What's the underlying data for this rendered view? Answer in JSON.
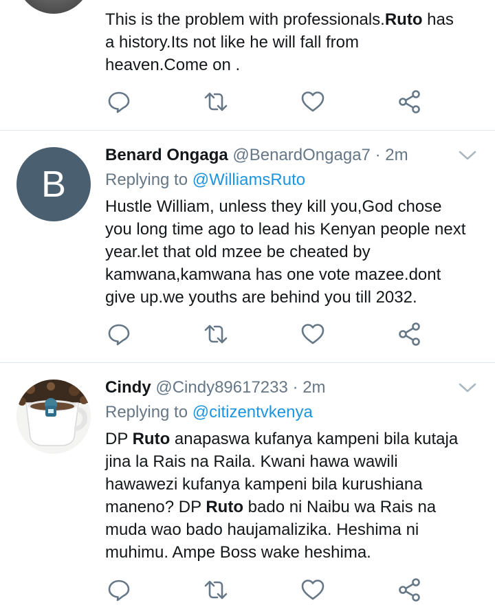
{
  "tweets": [
    {
      "avatar_letter": "",
      "body_lines": [
        [
          "This is the problem with professionals.",
          "Ruto",
          " has"
        ],
        [
          "a history.Its not like he will fall from",
          "",
          ""
        ],
        [
          "heaven.Come on .",
          "",
          ""
        ]
      ]
    },
    {
      "name": "Benard Ongaga",
      "handle": "@BenardOngaga7",
      "time": "· 2m",
      "reply_prefix": "Replying to",
      "reply_to": "@WilliamsRuto",
      "avatar_letter": "B",
      "body_lines": [
        [
          "Hustle William, unless they kill you,God chose",
          "",
          ""
        ],
        [
          "you long time ago to lead his Kenyan people next",
          "",
          ""
        ],
        [
          "year.let that old mzee be cheated by",
          "",
          ""
        ],
        [
          "kamwana,kamwana has one vote mazee.dont",
          "",
          ""
        ],
        [
          "give up.we youths are behind you till 2032.",
          "",
          ""
        ]
      ]
    },
    {
      "name": "Cindy",
      "handle": "@Cindy89617233",
      "time": "· 2m",
      "reply_prefix": "Replying to",
      "reply_to": "@citizentvkenya",
      "avatar_letter": "",
      "body_lines": [
        [
          "DP ",
          "Ruto",
          " anapaswa kufanya kampeni bila kutaja"
        ],
        [
          "jina la Rais na Raila.  Kwani hawa wawili",
          "",
          ""
        ],
        [
          "hawawezi kufanya kampeni bila kurushiana",
          "",
          ""
        ],
        [
          "maneno?  DP ",
          "Ruto",
          " bado ni Naibu wa Rais na"
        ],
        [
          "muda wao bado haujamalizika. Heshima ni",
          "",
          ""
        ],
        [
          "muhimu. Ampe Boss wake heshima.",
          "",
          ""
        ]
      ]
    }
  ],
  "icons": {
    "reply": "reply-icon",
    "retweet": "retweet-icon",
    "like": "like-icon",
    "share": "share-icon",
    "caret": "chevron-down-icon"
  },
  "colors": {
    "icon": "#657786",
    "link": "#1b95e0",
    "divider": "#e1e8ed",
    "avatar_b": "#4a5f6f"
  }
}
